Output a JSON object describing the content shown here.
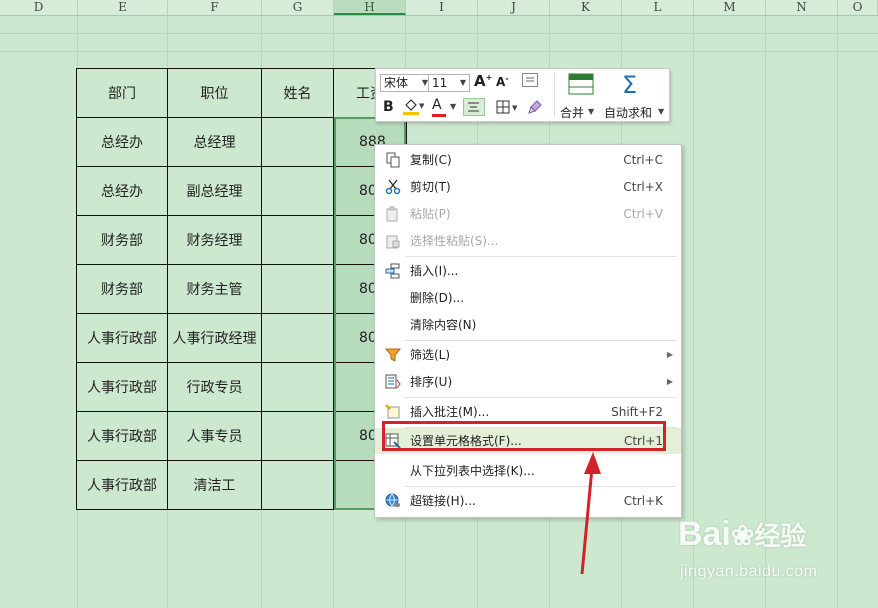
{
  "columns": [
    "D",
    "E",
    "F",
    "G",
    "H",
    "I",
    "J",
    "K",
    "L",
    "M",
    "N",
    "O"
  ],
  "active_column": "H",
  "table": {
    "header": [
      "部门",
      "职位",
      "姓名",
      "工资"
    ],
    "rows": [
      [
        "总经办",
        "总经理",
        "",
        "888"
      ],
      [
        "总经办",
        "副总经理",
        "",
        "80"
      ],
      [
        "财务部",
        "财务经理",
        "",
        "80"
      ],
      [
        "财务部",
        "财务主管",
        "",
        "80"
      ],
      [
        "人事行政部",
        "人事行政经理",
        "",
        "80"
      ],
      [
        "人事行政部",
        "行政专员",
        "",
        ""
      ],
      [
        "人事行政部",
        "人事专员",
        "",
        "80"
      ],
      [
        "人事行政部",
        "清洁工",
        "",
        ""
      ]
    ]
  },
  "mini_toolbar": {
    "font_name": "宋体",
    "font_size": "11",
    "bold": "B",
    "font_color_glyph": "A",
    "grow_font": "A",
    "shrink_font": "A",
    "merge_label": "合并",
    "autosum_label": "自动求和",
    "accent_red": "#e02020",
    "fill_yellow": "#f5c400"
  },
  "context_menu": {
    "items": [
      {
        "label": "复制(C)",
        "shortcut": "Ctrl+C",
        "icon": "copy-icon"
      },
      {
        "label": "剪切(T)",
        "shortcut": "Ctrl+X",
        "icon": "scissors-icon"
      },
      {
        "label": "粘贴(P)",
        "shortcut": "Ctrl+V",
        "icon": "paste-icon",
        "disabled": true
      },
      {
        "label": "选择性粘贴(S)...",
        "shortcut": "",
        "icon": "paste-special-icon",
        "disabled": true
      },
      {
        "label": "插入(I)...",
        "shortcut": "",
        "icon": "insert-icon"
      },
      {
        "label": "删除(D)...",
        "shortcut": "",
        "icon": ""
      },
      {
        "label": "清除内容(N)",
        "shortcut": "",
        "icon": ""
      },
      {
        "label": "筛选(L)",
        "shortcut": "",
        "icon": "filter-icon",
        "submenu": true
      },
      {
        "label": "排序(U)",
        "shortcut": "",
        "icon": "sort-icon",
        "submenu": true
      },
      {
        "label": "插入批注(M)...",
        "shortcut": "Shift+F2",
        "icon": "comment-icon"
      },
      {
        "label": "设置单元格格式(F)...",
        "shortcut": "Ctrl+1",
        "icon": "format-cells-icon",
        "highlighted": true
      },
      {
        "label": "从下拉列表中选择(K)...",
        "shortcut": "",
        "icon": ""
      },
      {
        "label": "超链接(H)...",
        "shortcut": "Ctrl+K",
        "icon": "hyperlink-icon"
      }
    ]
  },
  "watermark": {
    "brand": "Bai",
    "brand2": "经验",
    "url": "jingyan.baidu.com"
  },
  "colors": {
    "sheet_bg": "#cce8cf",
    "highlight_border": "#d2232a",
    "arrow": "#d2232a"
  }
}
